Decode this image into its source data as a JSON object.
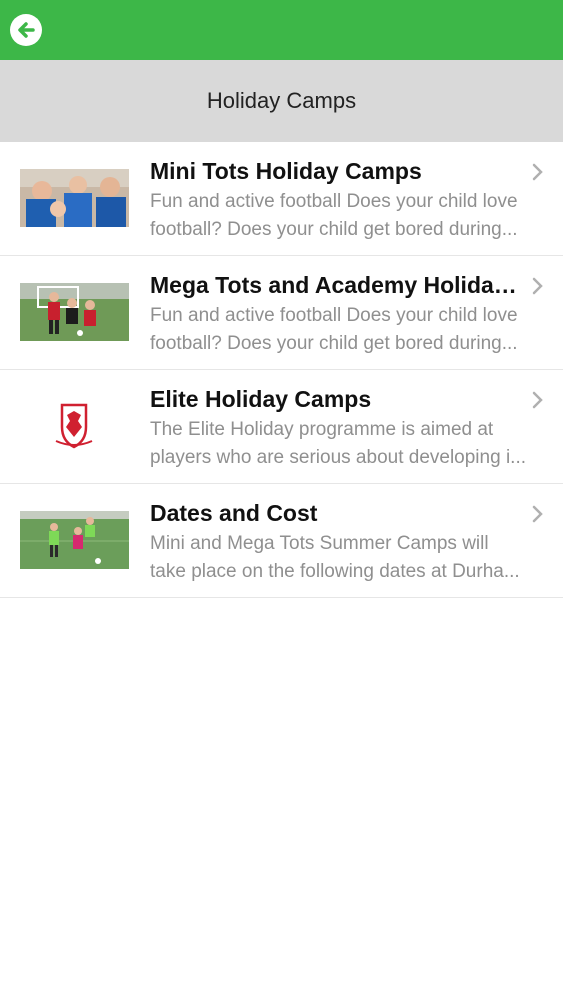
{
  "header": {
    "back_icon": "arrow-left-circle-icon",
    "bar_color": "#3db748"
  },
  "title": "Holiday Camps",
  "items": [
    {
      "title": "Mini Tots Holiday Camps",
      "desc_line1": "Fun and active football Does your child love",
      "desc_line2": "football? Does your child get bored during...",
      "thumb": "kids-group-photo"
    },
    {
      "title": "Mega Tots and Academy Holiday ...",
      "desc_line1": "Fun and active football Does your child love",
      "desc_line2": "football? Does your child get bored during...",
      "thumb": "kids-playing-football-photo"
    },
    {
      "title": "Elite Holiday Camps",
      "desc_line1": "The Elite Holiday programme is aimed at",
      "desc_line2": "players who are serious about developing i...",
      "thumb": "club-crest-logo"
    },
    {
      "title": "Dates and Cost",
      "desc_line1": "Mini and Mega Tots Summer Camps will",
      "desc_line2": "take place on the following dates at Durha...",
      "thumb": "kids-match-photo"
    }
  ]
}
